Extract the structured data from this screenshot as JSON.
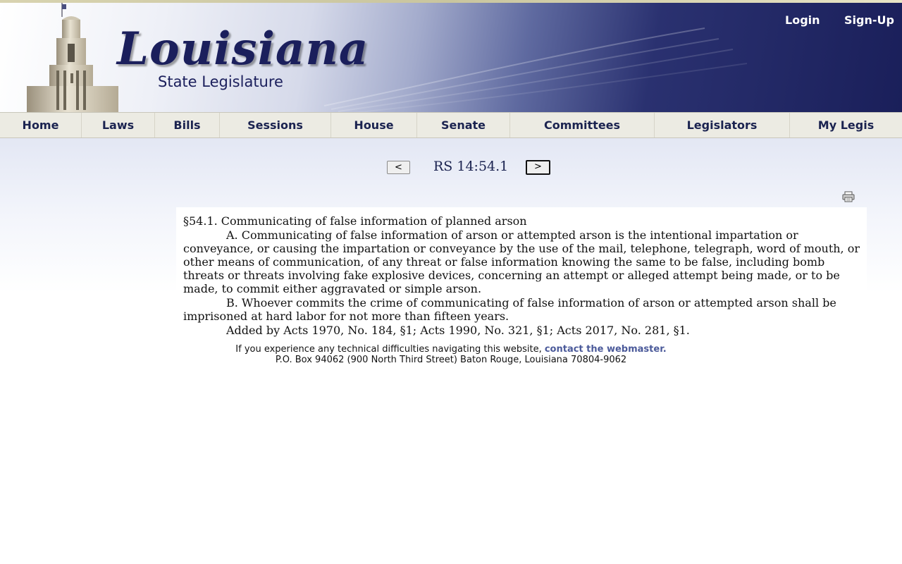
{
  "header": {
    "logo_main": "Louisiana",
    "logo_sub": "State Legislature",
    "login": "Login",
    "signup": "Sign-Up"
  },
  "nav": {
    "items": [
      "Home",
      "Laws",
      "Bills",
      "Sessions",
      "House",
      "Senate",
      "Committees",
      "Legislators",
      "My Legis"
    ]
  },
  "pager": {
    "prev": "<",
    "title": "RS 14:54.1",
    "next": ">"
  },
  "icons": {
    "print": "printer-icon"
  },
  "document": {
    "heading": "§54.1. Communicating of false information of planned arson",
    "para_a": "A. Communicating of false information of arson or attempted arson is the intentional impartation or conveyance, or causing the impartation or conveyance by the use of the mail, telephone, telegraph, word of mouth, or other means of communication, of any threat or false information knowing the same to be false, including bomb threats or threats involving fake explosive devices, concerning an attempt or alleged attempt being made, or to be made, to commit either aggravated or simple arson.",
    "para_b": "B. Whoever commits the crime of communicating of false information of arson or attempted arson shall be imprisoned at hard labor for not more than fifteen years.",
    "history": "Added by Acts 1970, No. 184, §1; Acts 1990, No. 321, §1; Acts 2017, No. 281, §1."
  },
  "footer": {
    "help_text": "If you experience any technical difficulties navigating this website, ",
    "help_link": "contact the webmaster.",
    "address": "P.O. Box 94062 (900 North Third Street) Baton Rouge, Louisiana 70804-9062"
  },
  "colors": {
    "navy": "#1b1f5c",
    "nav_bg": "#ecebe3",
    "link": "#4b5a9a"
  }
}
